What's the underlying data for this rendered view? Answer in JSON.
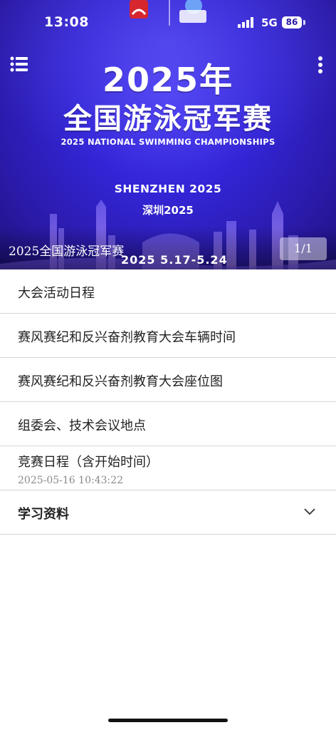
{
  "status_bar": {
    "time": "13:08",
    "network": "5G",
    "battery": "86"
  },
  "banner": {
    "title_line1": "2025年",
    "title_line2": "全国游泳冠军赛",
    "title_en": "2025 NATIONAL SWIMMING CHAMPIONSHIPS",
    "city_en": "SHENZHEN 2025",
    "city_cn": "深圳2025",
    "dates": "2025  5.17-5.24",
    "caption": "2025全国游泳冠军赛",
    "counter": "1/1"
  },
  "list": {
    "items": [
      {
        "label": "大会活动日程"
      },
      {
        "label": "赛风赛纪和反兴奋剂教育大会车辆时间"
      },
      {
        "label": "赛风赛纪和反兴奋剂教育大会座位图"
      },
      {
        "label": "组委会、技术会议地点"
      },
      {
        "label": "竞赛日程（含开始时间）",
        "date": "2025-05-16 10:43:22"
      },
      {
        "label": "学习资料"
      }
    ]
  },
  "icons": {
    "menu": "menu-list-icon",
    "more": "more-vertical-icon",
    "chevron": "chevron-down-icon",
    "signal": "signal-bars-icon",
    "battery": "battery-icon"
  },
  "colors": {
    "banner_blue": "#3325d6",
    "divider": "#d6d6d6",
    "date_gray": "#8a8a8a"
  }
}
